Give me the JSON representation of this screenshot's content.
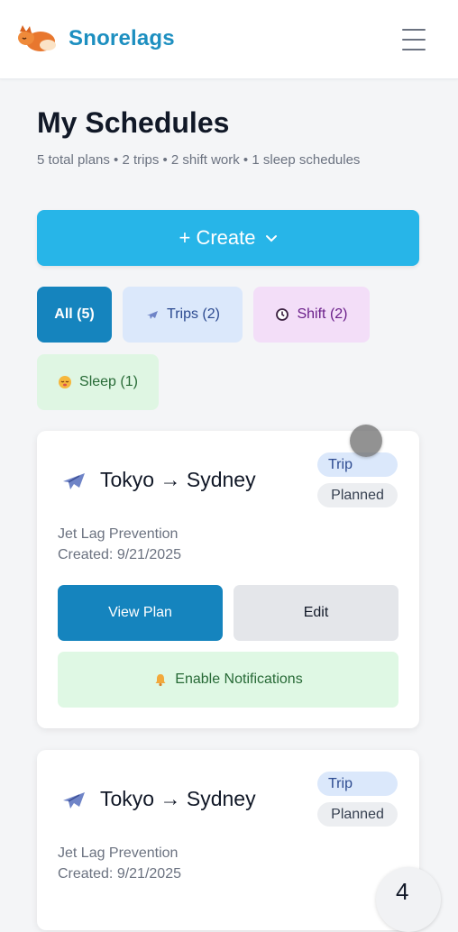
{
  "app": {
    "brand": "Snorelags",
    "logo": "fox-sleeping-logo",
    "menu_icon": "hamburger-menu-icon"
  },
  "page": {
    "title": "My Schedules",
    "summary": "5 total plans • 2 trips • 2 shift work • 1 sleep schedules"
  },
  "create": {
    "label": "+ Create",
    "icon": "chevron-down-icon"
  },
  "filters": [
    {
      "label": "All (5)",
      "active": true
    },
    {
      "label": "Trips (2)",
      "icon": "airplane-icon"
    },
    {
      "label": "Shift (2)",
      "icon": "clock-icon"
    },
    {
      "label": "Sleep (1)",
      "icon": "sleepy-face-icon"
    }
  ],
  "plans": [
    {
      "title": "Tokyo → Sydney",
      "type": "Trip",
      "status": "Planned",
      "kind": "Jet Lag Prevention",
      "created": "Created: 9/21/2025",
      "view_label": "View Plan",
      "edit_label": "Edit",
      "notify_label": "Enable Notifications"
    },
    {
      "title": "Tokyo → Sydney",
      "type": "Trip",
      "status": "Planned",
      "kind": "Jet Lag Prevention",
      "created": "Created: 9/21/2025"
    }
  ],
  "fab": {
    "label": "4"
  },
  "colors": {
    "brand": "#1d8fc0",
    "primary": "#1584be",
    "create": "#27b5e8",
    "trips_bg": "#dbe8fb",
    "shift_bg": "#f3def8",
    "sleep_bg": "#dff6e3"
  }
}
